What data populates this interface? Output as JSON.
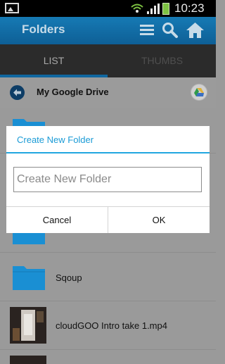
{
  "status_bar": {
    "time": "10:23",
    "icons": [
      "image-icon",
      "wifi-icon",
      "signal-icon",
      "battery-icon"
    ]
  },
  "action_bar": {
    "title": "Folders",
    "icons": [
      "menu-icon",
      "search-icon",
      "home-icon"
    ]
  },
  "tabs": [
    {
      "label": "LIST",
      "selected": true
    },
    {
      "label": "THUMBS",
      "selected": false
    }
  ],
  "breadcrumb": {
    "title": "My Google Drive"
  },
  "list": {
    "items": [
      {
        "label": "",
        "type": "folder"
      },
      {
        "label": "",
        "type": "folder"
      },
      {
        "label": "Sqoup",
        "type": "folder"
      },
      {
        "label": "cloudGOO Intro take 1.mp4",
        "type": "video"
      },
      {
        "label": "",
        "type": "video"
      }
    ]
  },
  "dialog": {
    "title": "Create New Folder",
    "input_placeholder": "Create New Folder",
    "cancel_label": "Cancel",
    "ok_label": "OK"
  },
  "colors": {
    "accent": "#1b9bd6",
    "action_bar": "#167ab4",
    "folder": "#1a8fd3"
  }
}
